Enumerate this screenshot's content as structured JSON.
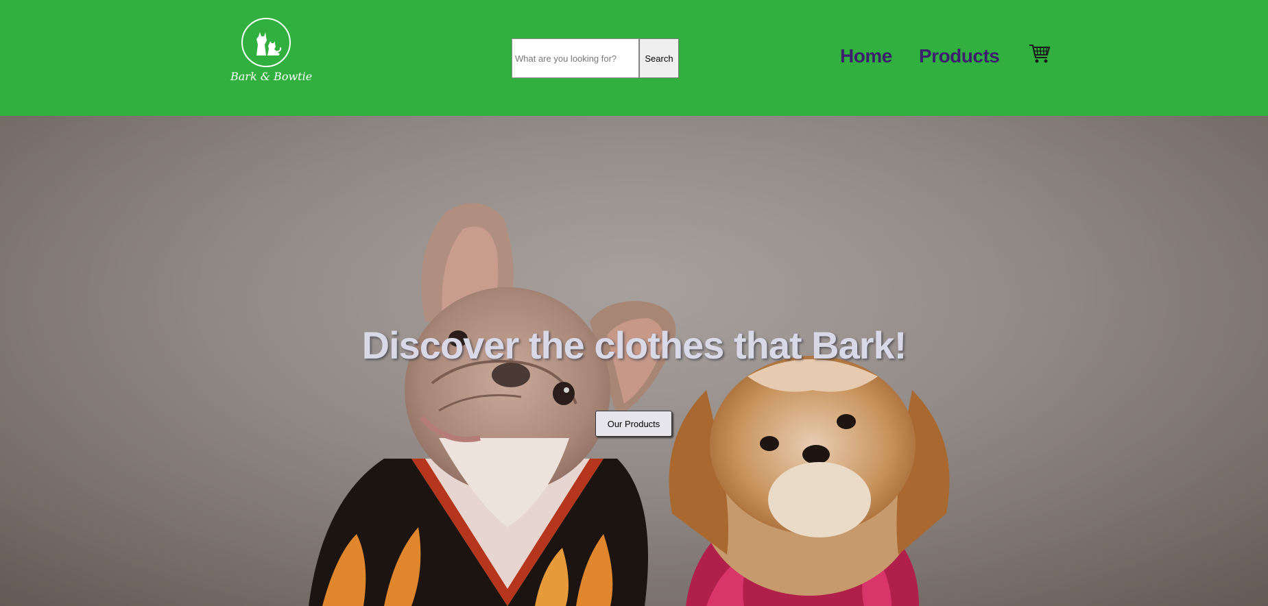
{
  "brand": {
    "name": "Bark & Bowtie",
    "logo_icon": "dog-and-cat-silhouette-icon"
  },
  "search": {
    "placeholder": "What are you looking for?",
    "value": "",
    "button_label": "Search"
  },
  "nav": {
    "items": [
      {
        "label": "Home"
      },
      {
        "label": "Products"
      }
    ],
    "cart_icon": "shopping-cart-icon"
  },
  "hero": {
    "title": "Discover the clothes that Bark!",
    "cta_label": "Our Products",
    "image_subject": "french-bulldog-and-shih-tzu-in-shirts"
  },
  "colors": {
    "header_bg": "#31b03f",
    "nav_link": "#3d1f6e",
    "hero_title": "#d8d8e6"
  }
}
